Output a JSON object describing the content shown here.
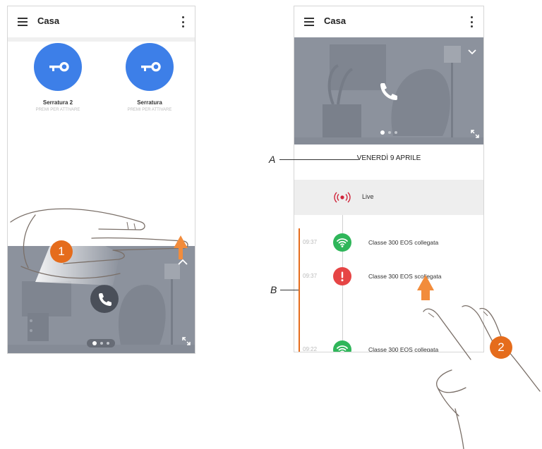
{
  "phone1": {
    "title": "Casa",
    "locks": [
      {
        "name": "Serratura 2",
        "hint": "PREMI PER ATTIVARE"
      },
      {
        "name": "Serratura",
        "hint": "PREMI PER ATTIVARE"
      }
    ],
    "step_badge": "1"
  },
  "phone2": {
    "title": "Casa",
    "date": "VENERDÌ 9 APRILE",
    "live_label": "Live",
    "events": [
      {
        "time": "09:37",
        "text": "Classe 300 EOS collegata",
        "status": "connected"
      },
      {
        "time": "09:37",
        "text": "Classe 300 EOS scollegata",
        "status": "disconnected"
      },
      {
        "time": "09:22",
        "text": "Classe 300 EOS collegata",
        "status": "connected"
      }
    ],
    "step_badge": "2"
  },
  "annotations": {
    "a": "A",
    "b": "B"
  },
  "colors": {
    "accent_blue": "#3d7fe8",
    "connected_green": "#2fb65a",
    "disconnected_red": "#e64545",
    "live_red": "#d0243a",
    "step_orange": "#e56c1c"
  }
}
